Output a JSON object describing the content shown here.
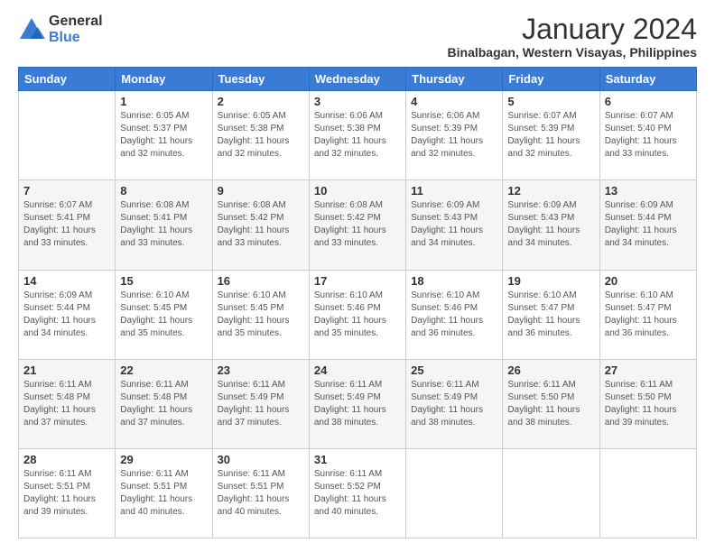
{
  "logo": {
    "general": "General",
    "blue": "Blue"
  },
  "title": "January 2024",
  "subtitle": "Binalbagan, Western Visayas, Philippines",
  "weekdays": [
    "Sunday",
    "Monday",
    "Tuesday",
    "Wednesday",
    "Thursday",
    "Friday",
    "Saturday"
  ],
  "weeks": [
    [
      {
        "day": "",
        "sunrise": "",
        "sunset": "",
        "daylight": ""
      },
      {
        "day": "1",
        "sunrise": "6:05 AM",
        "sunset": "5:37 PM",
        "daylight": "11 hours and 32 minutes."
      },
      {
        "day": "2",
        "sunrise": "6:05 AM",
        "sunset": "5:38 PM",
        "daylight": "11 hours and 32 minutes."
      },
      {
        "day": "3",
        "sunrise": "6:06 AM",
        "sunset": "5:38 PM",
        "daylight": "11 hours and 32 minutes."
      },
      {
        "day": "4",
        "sunrise": "6:06 AM",
        "sunset": "5:39 PM",
        "daylight": "11 hours and 32 minutes."
      },
      {
        "day": "5",
        "sunrise": "6:07 AM",
        "sunset": "5:39 PM",
        "daylight": "11 hours and 32 minutes."
      },
      {
        "day": "6",
        "sunrise": "6:07 AM",
        "sunset": "5:40 PM",
        "daylight": "11 hours and 33 minutes."
      }
    ],
    [
      {
        "day": "7",
        "sunrise": "6:07 AM",
        "sunset": "5:41 PM",
        "daylight": "11 hours and 33 minutes."
      },
      {
        "day": "8",
        "sunrise": "6:08 AM",
        "sunset": "5:41 PM",
        "daylight": "11 hours and 33 minutes."
      },
      {
        "day": "9",
        "sunrise": "6:08 AM",
        "sunset": "5:42 PM",
        "daylight": "11 hours and 33 minutes."
      },
      {
        "day": "10",
        "sunrise": "6:08 AM",
        "sunset": "5:42 PM",
        "daylight": "11 hours and 33 minutes."
      },
      {
        "day": "11",
        "sunrise": "6:09 AM",
        "sunset": "5:43 PM",
        "daylight": "11 hours and 34 minutes."
      },
      {
        "day": "12",
        "sunrise": "6:09 AM",
        "sunset": "5:43 PM",
        "daylight": "11 hours and 34 minutes."
      },
      {
        "day": "13",
        "sunrise": "6:09 AM",
        "sunset": "5:44 PM",
        "daylight": "11 hours and 34 minutes."
      }
    ],
    [
      {
        "day": "14",
        "sunrise": "6:09 AM",
        "sunset": "5:44 PM",
        "daylight": "11 hours and 34 minutes."
      },
      {
        "day": "15",
        "sunrise": "6:10 AM",
        "sunset": "5:45 PM",
        "daylight": "11 hours and 35 minutes."
      },
      {
        "day": "16",
        "sunrise": "6:10 AM",
        "sunset": "5:45 PM",
        "daylight": "11 hours and 35 minutes."
      },
      {
        "day": "17",
        "sunrise": "6:10 AM",
        "sunset": "5:46 PM",
        "daylight": "11 hours and 35 minutes."
      },
      {
        "day": "18",
        "sunrise": "6:10 AM",
        "sunset": "5:46 PM",
        "daylight": "11 hours and 36 minutes."
      },
      {
        "day": "19",
        "sunrise": "6:10 AM",
        "sunset": "5:47 PM",
        "daylight": "11 hours and 36 minutes."
      },
      {
        "day": "20",
        "sunrise": "6:10 AM",
        "sunset": "5:47 PM",
        "daylight": "11 hours and 36 minutes."
      }
    ],
    [
      {
        "day": "21",
        "sunrise": "6:11 AM",
        "sunset": "5:48 PM",
        "daylight": "11 hours and 37 minutes."
      },
      {
        "day": "22",
        "sunrise": "6:11 AM",
        "sunset": "5:48 PM",
        "daylight": "11 hours and 37 minutes."
      },
      {
        "day": "23",
        "sunrise": "6:11 AM",
        "sunset": "5:49 PM",
        "daylight": "11 hours and 37 minutes."
      },
      {
        "day": "24",
        "sunrise": "6:11 AM",
        "sunset": "5:49 PM",
        "daylight": "11 hours and 38 minutes."
      },
      {
        "day": "25",
        "sunrise": "6:11 AM",
        "sunset": "5:49 PM",
        "daylight": "11 hours and 38 minutes."
      },
      {
        "day": "26",
        "sunrise": "6:11 AM",
        "sunset": "5:50 PM",
        "daylight": "11 hours and 38 minutes."
      },
      {
        "day": "27",
        "sunrise": "6:11 AM",
        "sunset": "5:50 PM",
        "daylight": "11 hours and 39 minutes."
      }
    ],
    [
      {
        "day": "28",
        "sunrise": "6:11 AM",
        "sunset": "5:51 PM",
        "daylight": "11 hours and 39 minutes."
      },
      {
        "day": "29",
        "sunrise": "6:11 AM",
        "sunset": "5:51 PM",
        "daylight": "11 hours and 40 minutes."
      },
      {
        "day": "30",
        "sunrise": "6:11 AM",
        "sunset": "5:51 PM",
        "daylight": "11 hours and 40 minutes."
      },
      {
        "day": "31",
        "sunrise": "6:11 AM",
        "sunset": "5:52 PM",
        "daylight": "11 hours and 40 minutes."
      },
      {
        "day": "",
        "sunrise": "",
        "sunset": "",
        "daylight": ""
      },
      {
        "day": "",
        "sunrise": "",
        "sunset": "",
        "daylight": ""
      },
      {
        "day": "",
        "sunrise": "",
        "sunset": "",
        "daylight": ""
      }
    ]
  ]
}
